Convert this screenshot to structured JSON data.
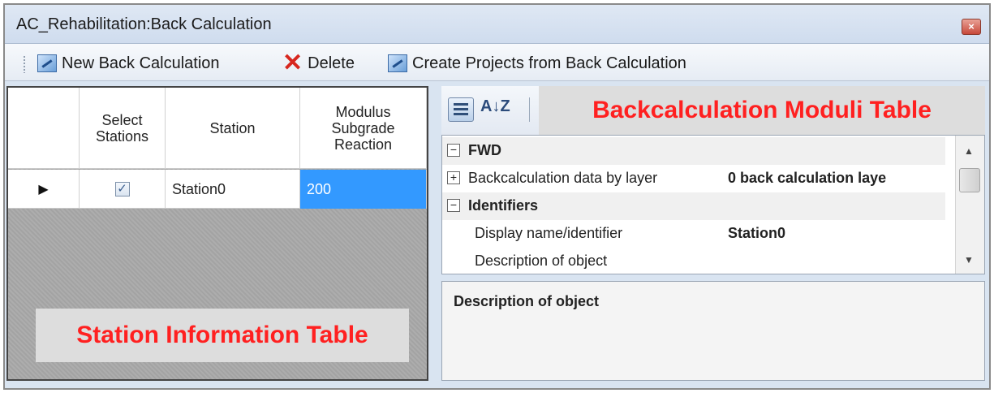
{
  "window": {
    "title": "AC_Rehabilitation:Back Calculation",
    "close_glyph": "×"
  },
  "toolbar": {
    "new_label": "New Back Calculation",
    "delete_label": "Delete",
    "create_label": "Create Projects from Back Calculation"
  },
  "station_table": {
    "headers": [
      "Select Stations",
      "Station",
      "Modulus Subgrade Reaction"
    ],
    "rows": [
      {
        "pointer": "▶",
        "checked": "✓",
        "station": "Station0",
        "modulus": "200"
      }
    ],
    "overlay_label": "Station Information Table"
  },
  "property_grid": {
    "overlay_label": "Backcalculation Moduli Table",
    "sort_glyph": "A↓Z",
    "sections": [
      {
        "label": "FWD",
        "toggle": "−"
      },
      {
        "label": "Identifiers",
        "toggle": "−"
      }
    ],
    "rows": [
      {
        "toggle": "+",
        "name": "Backcalculation data by layer",
        "value": "0 back calculation laye"
      },
      {
        "name": "Display name/identifier",
        "value": "Station0"
      },
      {
        "name": "Description of object",
        "value": ""
      }
    ],
    "scroll_up": "▲",
    "scroll_down": "▼",
    "description_title": "Description of object"
  }
}
